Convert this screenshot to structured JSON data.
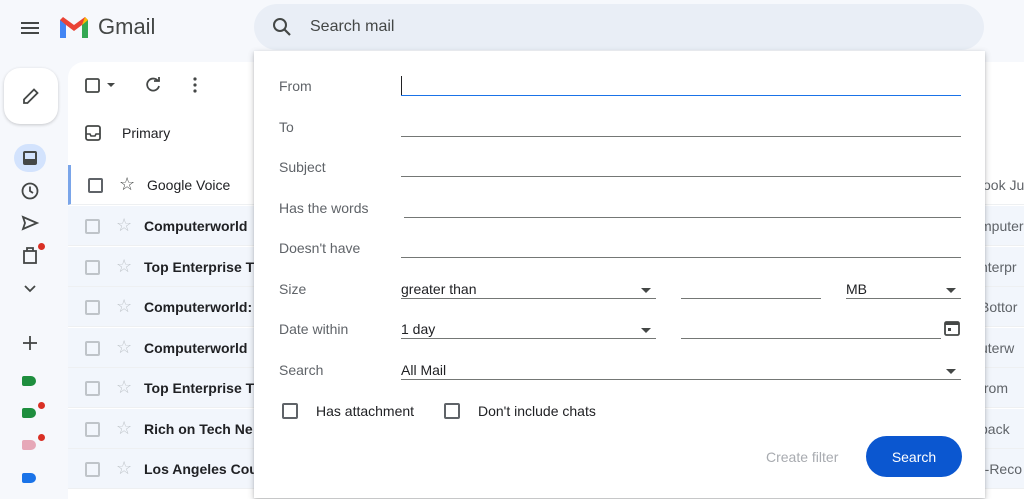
{
  "header": {
    "app_name": "Gmail",
    "search_placeholder": "Search mail"
  },
  "tabs": {
    "primary": "Primary"
  },
  "rows": [
    {
      "sender": "Google Voice",
      "snippet": "ook Ju",
      "selected": true
    },
    {
      "sender": "Computerworld",
      "snippet": "mputer",
      "selected": false
    },
    {
      "sender": "Top Enterprise T",
      "snippet": "nterpr",
      "selected": false
    },
    {
      "sender": "Computerworld:",
      "snippet": "Bottor",
      "selected": false
    },
    {
      "sender": "Computerworld",
      "snippet": "uterw",
      "selected": false
    },
    {
      "sender": "Top Enterprise T",
      "snippet": "from",
      "selected": false
    },
    {
      "sender": "Rich on Tech Ne",
      "snippet": "back",
      "selected": false
    },
    {
      "sender": "Los Angeles Cou",
      "snippet": "r-Reco",
      "selected": false
    }
  ],
  "advanced_search": {
    "from_label": "From",
    "to_label": "To",
    "subject_label": "Subject",
    "has_words_label": "Has the words",
    "doesnt_have_label": "Doesn't have",
    "size_label": "Size",
    "size_operator": "greater than",
    "size_unit": "MB",
    "date_within_label": "Date within",
    "date_within_value": "1 day",
    "search_label": "Search",
    "search_scope": "All Mail",
    "has_attachment": "Has attachment",
    "dont_include_chats": "Don't include chats",
    "create_filter": "Create filter",
    "search_button": "Search"
  },
  "colors": {
    "accent": "#0b57d0",
    "unread_dot": "#d93025",
    "label_green": "#1e8e3e",
    "label_pink": "#e6a8b8",
    "label_blue": "#1a73e8"
  }
}
